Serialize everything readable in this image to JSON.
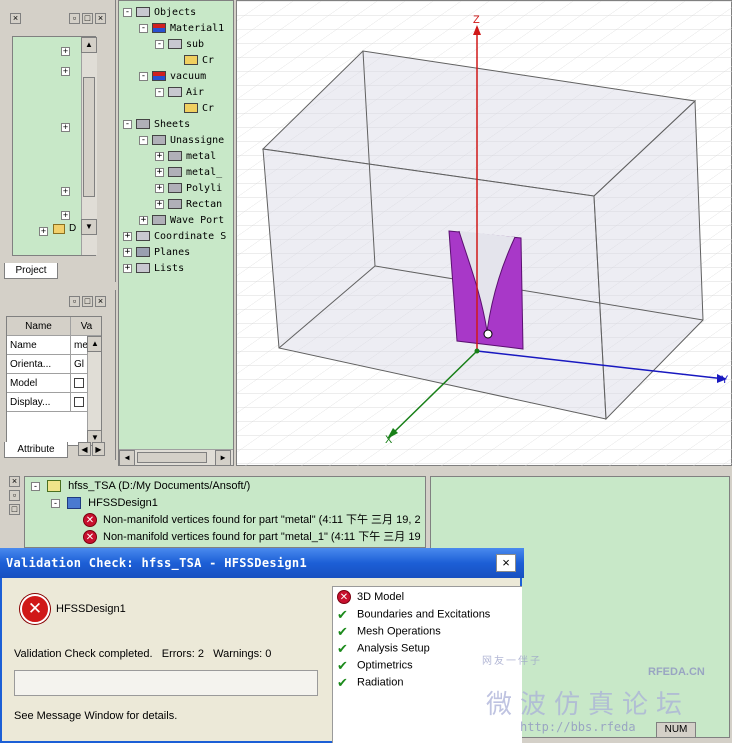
{
  "project_panel": {
    "tab_label": "Project",
    "tree_letter": "D"
  },
  "object_tree": {
    "rows": [
      {
        "label": "Objects",
        "indent": 0,
        "pm": "-",
        "icon": "object-icon"
      },
      {
        "label": "Material1",
        "indent": 1,
        "pm": "-",
        "icon": "material-icon"
      },
      {
        "label": "sub",
        "indent": 2,
        "pm": "-",
        "icon": "solid-icon"
      },
      {
        "label": "Cr",
        "indent": 3,
        "pm": "",
        "icon": "create-icon"
      },
      {
        "label": "vacuum",
        "indent": 1,
        "pm": "-",
        "icon": "material-icon"
      },
      {
        "label": "Air",
        "indent": 2,
        "pm": "-",
        "icon": "solid-icon"
      },
      {
        "label": "Cr",
        "indent": 3,
        "pm": "",
        "icon": "create-icon"
      },
      {
        "label": "Sheets",
        "indent": 0,
        "pm": "-",
        "icon": "sheet-icon"
      },
      {
        "label": "Unassigne",
        "indent": 1,
        "pm": "-",
        "icon": "sheet-icon"
      },
      {
        "label": "metal",
        "indent": 2,
        "pm": "+",
        "icon": "sheet-icon"
      },
      {
        "label": "metal_",
        "indent": 2,
        "pm": "+",
        "icon": "sheet-icon"
      },
      {
        "label": "Polyli",
        "indent": 2,
        "pm": "+",
        "icon": "sheet-icon"
      },
      {
        "label": "Rectan",
        "indent": 2,
        "pm": "+",
        "icon": "sheet-icon"
      },
      {
        "label": "Wave Port",
        "indent": 1,
        "pm": "+",
        "icon": "sheet-icon"
      },
      {
        "label": "Coordinate S",
        "indent": 0,
        "pm": "+",
        "icon": "coord-icon"
      },
      {
        "label": "Planes",
        "indent": 0,
        "pm": "+",
        "icon": "plane-icon"
      },
      {
        "label": "Lists",
        "indent": 0,
        "pm": "+",
        "icon": "list-icon"
      }
    ]
  },
  "properties": {
    "col_name": "Name",
    "col_value": "Va",
    "rows": [
      {
        "name": "Name",
        "value": "me"
      },
      {
        "name": "Orienta...",
        "value": "Gl"
      },
      {
        "name": "Model",
        "value": ""
      },
      {
        "name": "Display...",
        "value": ""
      }
    ],
    "tab_label": "Attribute"
  },
  "viewport": {
    "axis_z": "Z",
    "axis_y": "Y",
    "axis_x": "X"
  },
  "message_window": {
    "project": "hfss_TSA (D:/My Documents/Ansoft/)",
    "design": "HFSSDesign1",
    "messages": [
      "Non-manifold vertices found for part \"metal\" (4:11 下午  三月 19, 2",
      "Non-manifold vertices found for part \"metal_1\" (4:11 下午  三月 19"
    ]
  },
  "dialog": {
    "title": "Validation Check: hfss_TSA - HFSSDesign1",
    "design_name": "HFSSDesign1",
    "status": "Validation Check completed.   Errors: 2   Warnings: 0",
    "footer": "See Message Window for details.",
    "checks": [
      {
        "label": "3D Model",
        "status": "error"
      },
      {
        "label": "Boundaries and Excitations",
        "status": "ok"
      },
      {
        "label": "Mesh Operations",
        "status": "ok"
      },
      {
        "label": "Analysis Setup",
        "status": "ok"
      },
      {
        "label": "Optimetrics",
        "status": "ok"
      },
      {
        "label": "Radiation",
        "status": "ok"
      }
    ]
  },
  "watermark": {
    "small": "网友一伴子",
    "logo": "RFEDA.CN",
    "big": "微波仿真论坛",
    "url": "http://bbs.rfeda"
  },
  "statusbar": {
    "num": "NUM"
  },
  "colors": {
    "tree_bg": "#c8e8c8",
    "dialog_title": "#1c5fd6",
    "axis_z": "#d01818",
    "axis_y": "#1818c0",
    "axis_x": "#188018",
    "part": "#a838c8"
  }
}
